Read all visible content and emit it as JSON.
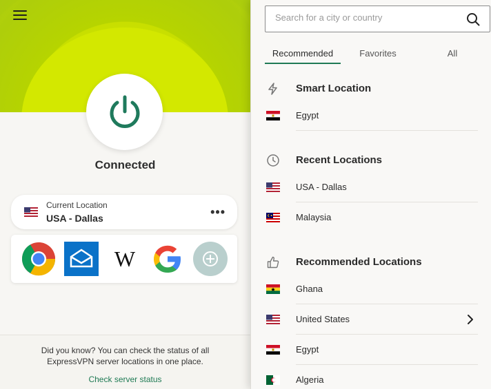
{
  "left": {
    "status": "Connected",
    "current_location": {
      "caption": "Current Location",
      "value": "USA - Dallas"
    },
    "shortcuts": [
      {
        "name": "chrome"
      },
      {
        "name": "mail"
      },
      {
        "name": "wikipedia",
        "glyph": "W"
      },
      {
        "name": "google"
      },
      {
        "name": "add-shortcut"
      }
    ],
    "footer": {
      "tip_line1": "Did you know? You can check the status of all",
      "tip_line2": "ExpressVPN server locations in one place.",
      "link": "Check server status"
    }
  },
  "right": {
    "search": {
      "placeholder": "Search for a city or country",
      "value": ""
    },
    "tabs": [
      "Recommended",
      "Favorites",
      "All"
    ],
    "smart": {
      "title": "Smart Location",
      "items": [
        "Egypt"
      ]
    },
    "recent": {
      "title": "Recent Locations",
      "items": [
        "USA - Dallas",
        "Malaysia"
      ]
    },
    "recommended": {
      "title": "Recommended Locations",
      "items": [
        "Ghana",
        "United States",
        "Egypt",
        "Algeria"
      ]
    }
  },
  "colors": {
    "accent_green": "#1f7a54",
    "hero_yellow": "#c8df00"
  }
}
